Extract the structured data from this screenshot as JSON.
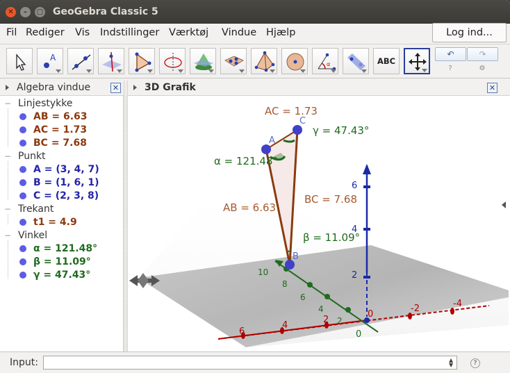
{
  "window": {
    "title": "GeoGebra Classic 5",
    "close_glyph": "✕",
    "minimize_glyph": "–",
    "maximize_glyph": "▢"
  },
  "menu": {
    "items": [
      "Fil",
      "Rediger",
      "Vis",
      "Indstillinger",
      "Værktøj",
      "Vindue",
      "Hjælp"
    ],
    "login_label": "Log ind..."
  },
  "toolbar": {
    "tools": [
      {
        "icon": "move-arrow-icon"
      },
      {
        "icon": "point-icon",
        "label": "A"
      },
      {
        "icon": "line-icon"
      },
      {
        "icon": "perpendicular-line-icon"
      },
      {
        "icon": "polygon-icon"
      },
      {
        "icon": "circle-axis-icon"
      },
      {
        "icon": "intersect-surfaces-icon"
      },
      {
        "icon": "plane-icon"
      },
      {
        "icon": "pyramid-icon"
      },
      {
        "icon": "sphere-icon"
      },
      {
        "icon": "angle-icon"
      },
      {
        "icon": "reflect-icon"
      },
      {
        "icon": "text-icon",
        "label": "ABC"
      },
      {
        "icon": "move-graphics-view-icon"
      }
    ],
    "undo_glyph": "↶",
    "redo_glyph": "↷",
    "help_glyph": "?",
    "settings_glyph": "⚙"
  },
  "algebra": {
    "title": "Algebra vindue",
    "close_glyph": "✕",
    "categories": [
      {
        "name": "Linjestykke",
        "items": [
          {
            "text": "AB = 6.63",
            "color": "#8b3a0e"
          },
          {
            "text": "AC = 1.73",
            "color": "#8b3a0e"
          },
          {
            "text": "BC = 7.68",
            "color": "#8b3a0e"
          }
        ]
      },
      {
        "name": "Punkt",
        "items": [
          {
            "text": "A = (3, 4, 7)",
            "color": "#2424a8"
          },
          {
            "text": "B = (1, 6, 1)",
            "color": "#2424a8"
          },
          {
            "text": "C = (2, 3, 8)",
            "color": "#2424a8"
          }
        ]
      },
      {
        "name": "Trekant",
        "items": [
          {
            "text": "t1 = 4.9",
            "color": "#8b3a0e"
          }
        ]
      },
      {
        "name": "Vinkel",
        "items": [
          {
            "text": "α = 121.48°",
            "color": "#1f6b1f"
          },
          {
            "text": "β = 11.09°",
            "color": "#1f6b1f"
          },
          {
            "text": "γ = 47.43°",
            "color": "#1f6b1f"
          }
        ]
      }
    ]
  },
  "view3d": {
    "title": "3D Grafik",
    "close_glyph": "✕",
    "labels": {
      "ac": "AC = 1.73",
      "gamma": "γ = 47.43°",
      "alpha": "α = 121.48°",
      "ab": "AB = 6.63",
      "bc": "BC = 7.68",
      "beta": "β = 11.09°",
      "point_a": "A",
      "point_b": "B",
      "point_c": "C"
    },
    "z_ticks": [
      "6",
      "4",
      "2",
      "0"
    ],
    "x_ticks": [
      "6",
      "4",
      "2",
      "0"
    ],
    "y_ticks_neg": [
      "-2",
      "-4"
    ],
    "y_ticks_green": [
      "10",
      "8",
      "6",
      "4",
      "2"
    ],
    "origin_label_red": "0",
    "colors": {
      "segment": "#8b3a0e",
      "angle": "#1f6b1f",
      "point": "#4040c8",
      "z_axis": "#1a2aa8",
      "x_axis": "#b00000",
      "y_axis": "#1f6b1f"
    }
  },
  "input": {
    "label": "Input:",
    "value": "",
    "help_glyph": "?"
  }
}
